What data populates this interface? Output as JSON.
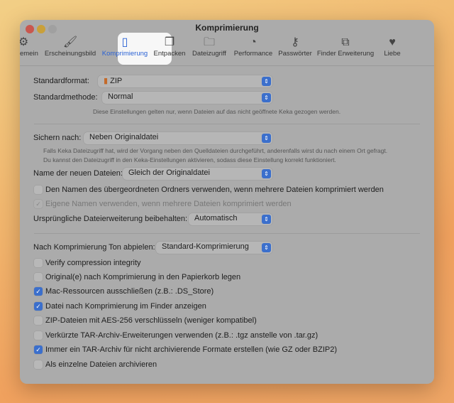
{
  "window": {
    "title": "Komprimierung"
  },
  "toolbar": [
    {
      "label": "Allgemein",
      "icon": "gear-icon",
      "glyph": "⚙"
    },
    {
      "label": "Erscheinungsbild",
      "icon": "brush-icon",
      "glyph": "🖌"
    },
    {
      "label": "Komprimierung",
      "icon": "zip-icon",
      "glyph": "▯"
    },
    {
      "label": "Entpacken",
      "icon": "documents-icon",
      "glyph": "❐"
    },
    {
      "label": "Dateizugriff",
      "icon": "folder-icon",
      "glyph": "🗀"
    },
    {
      "label": "Performance",
      "icon": "gauge-icon",
      "glyph": "◔"
    },
    {
      "label": "Passwörter",
      "icon": "key-icon",
      "glyph": "⚷"
    },
    {
      "label": "Finder Erweiterung",
      "icon": "puzzle-icon",
      "glyph": "⧉"
    },
    {
      "label": "Liebe",
      "icon": "heart-icon",
      "glyph": "♥"
    }
  ],
  "format": {
    "label": "Standardformat:",
    "value": "ZIP",
    "method_label": "Standardmethode:",
    "method_value": "Normal",
    "note": "Diese Einstellungen gelten nur, wenn Dateien auf das nicht geöffnete Keka gezogen werden."
  },
  "save": {
    "label": "Sichern nach:",
    "value": "Neben Originaldatei",
    "note1": "Falls Keka Dateizugriff hat, wird der Vorgang neben den Quelldateien durchgeführt, anderenfalls wirst du nach einem Ort gefragt.",
    "note2": "Du kannst den Dateizugriff in den Keka-Einstellungen aktivieren, sodass diese Einstellung korrekt funktioniert.",
    "name_label": "Name der neuen Dateien:",
    "name_value": "Gleich der Originaldatei",
    "cb_parent": "Den Namen des übergeordneten Ordners verwenden, wenn mehrere Dateien komprimiert werden",
    "cb_own": "Eigene Namen verwenden, wenn mehrere Dateien komprimiert werden",
    "ext_label": "Ursprüngliche Dateierweiterung beibehalten:",
    "ext_value": "Automatisch"
  },
  "sound": {
    "label": "Nach Komprimierung Ton abpielen:",
    "value": "Standard-Komprimierung"
  },
  "options": [
    {
      "label": "Verify compression integrity",
      "checked": false
    },
    {
      "label": "Original(e) nach Komprimierung in den Papierkorb legen",
      "checked": false
    },
    {
      "label": "Mac-Ressourcen ausschließen (z.B.: .DS_Store)",
      "checked": true
    },
    {
      "label": "Datei nach Komprimierung im Finder anzeigen",
      "checked": true
    },
    {
      "label": "ZIP-Dateien mit AES-256 verschlüsseln (weniger kompatibel)",
      "checked": false
    },
    {
      "label": "Verkürzte TAR-Archiv-Erweiterungen verwenden (z.B.: .tgz anstelle von .tar.gz)",
      "checked": false
    },
    {
      "label": "Immer ein TAR-Archiv für nicht archivierende Formate erstellen (wie GZ oder BZIP2)",
      "checked": true
    },
    {
      "label": "Als einzelne Dateien archivieren",
      "checked": false
    }
  ]
}
